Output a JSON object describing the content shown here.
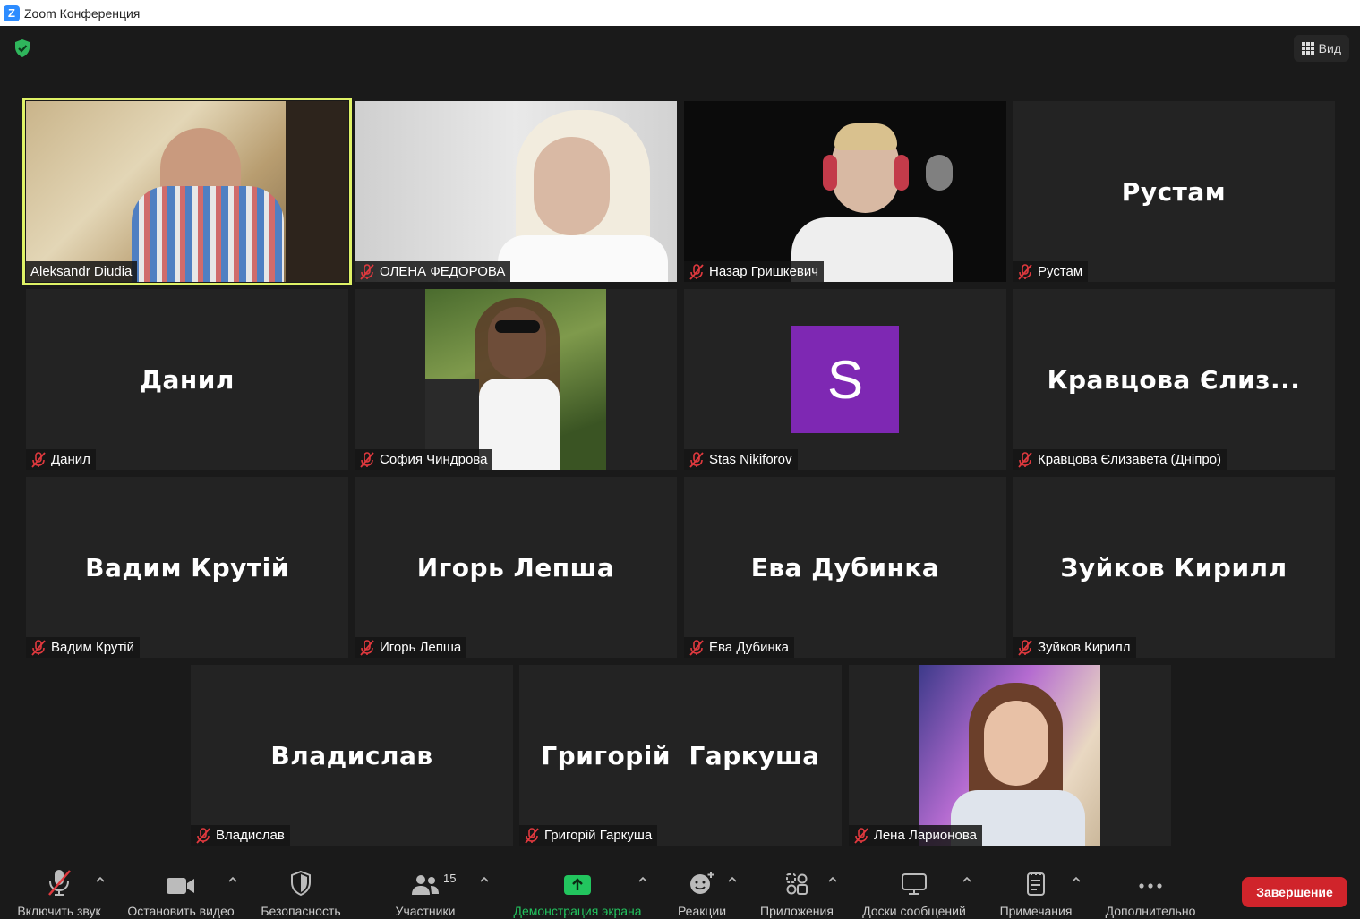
{
  "window": {
    "title": "Zoom Конференция",
    "app_icon": "zoom-logo"
  },
  "top": {
    "view_label": "Вид",
    "security_status_icon": "shield-check-icon"
  },
  "active_speaker": "Aleksandr Diudia",
  "participants": [
    {
      "name": "Aleksandr Diudia",
      "muted": false,
      "video": true
    },
    {
      "name": "ОЛЕНА ФЕДОРОВА",
      "muted": true,
      "video": true
    },
    {
      "name": "Назар Гришкевич",
      "muted": true,
      "video": true
    },
    {
      "name": "Рустам",
      "display": "Рустам",
      "muted": true,
      "video": false
    },
    {
      "name": "Данил",
      "display": "Данил",
      "muted": true,
      "video": false
    },
    {
      "name": "София Чиндрова",
      "muted": true,
      "video": false,
      "profile_photo": true
    },
    {
      "name": "Stas Nikiforov",
      "avatar_letter": "S",
      "avatar_color": "#7e28b3",
      "muted": true,
      "video": false
    },
    {
      "name": "Кравцова Єлизавета (Дніпро)",
      "display": "Кравцова Єлиз...",
      "muted": true,
      "video": false
    },
    {
      "name": "Вадим Крутій",
      "display": "Вадим Крутій",
      "muted": true,
      "video": false
    },
    {
      "name": "Игорь Лепша",
      "display": "Игорь Лепша",
      "muted": true,
      "video": false
    },
    {
      "name": "Ева Дубинка",
      "display": "Ева Дубинка",
      "muted": true,
      "video": false
    },
    {
      "name": "Зуйков Кирилл",
      "display": "Зуйков Кирилл",
      "muted": true,
      "video": false
    },
    {
      "name": "Владислав",
      "display": "Владислав",
      "muted": true,
      "video": false
    },
    {
      "name": "Григорій Гаркуша",
      "display": "Григорій  Гаркуша",
      "muted": true,
      "video": false
    },
    {
      "name": "Лена Ларионова",
      "muted": true,
      "video": false,
      "profile_photo": true
    }
  ],
  "toolbar": {
    "unmute": "Включить звук",
    "stop_video": "Остановить видео",
    "security": "Безопасность",
    "participants": "Участники",
    "participants_count": "15",
    "share_screen": "Демонстрация экрана",
    "reactions": "Реакции",
    "apps": "Приложения",
    "whiteboards": "Доски сообщений",
    "notes": "Примечания",
    "more": "Дополнительно",
    "end": "Завершение"
  },
  "colors": {
    "active_border": "#dff266",
    "share_green": "#22c55e",
    "end_red": "#d0242b",
    "muted_red": "#e0393e"
  }
}
